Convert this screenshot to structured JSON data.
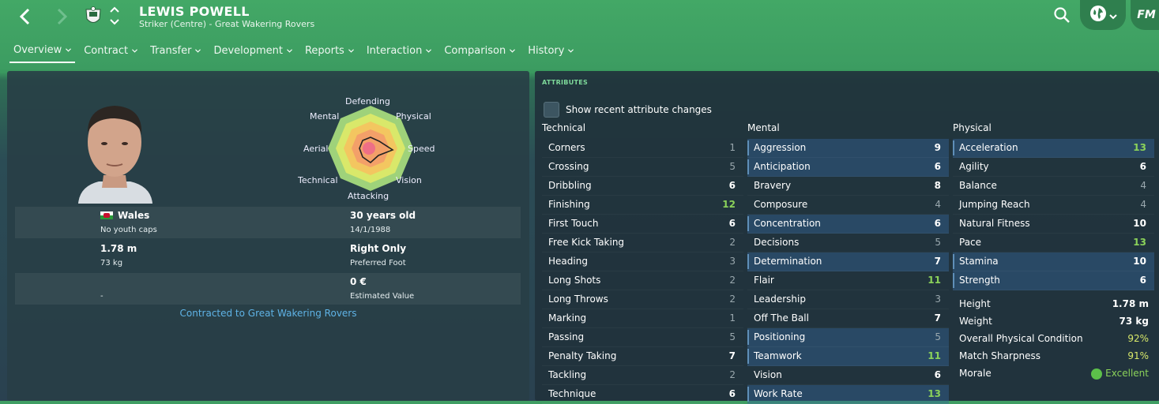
{
  "header": {
    "player_name": "LEWIS POWELL",
    "subtitle": "Striker (Centre) - Great Wakering Rovers",
    "logo_text": "FM"
  },
  "tabs": [
    {
      "label": "Overview",
      "active": true
    },
    {
      "label": "Contract"
    },
    {
      "label": "Transfer"
    },
    {
      "label": "Development"
    },
    {
      "label": "Reports"
    },
    {
      "label": "Interaction"
    },
    {
      "label": "Comparison"
    },
    {
      "label": "History"
    }
  ],
  "radar": {
    "labels": {
      "defending": "Defending",
      "physical": "Physical",
      "speed": "Speed",
      "vision": "Vision",
      "attacking": "Attacking",
      "technical": "Technical",
      "aerial": "Aerial",
      "mental": "Mental"
    }
  },
  "profile": {
    "nationality": "Wales",
    "youth_caps": "No youth caps",
    "age": "30 years old",
    "dob": "14/1/1988",
    "height": "1.78 m",
    "weight": "73 kg",
    "foot": "Right Only",
    "foot_label": "Preferred Foot",
    "value": "0 €",
    "value_label": "Estimated Value",
    "unknown": "-",
    "contract": "Contracted to Great Wakering Rovers"
  },
  "attributes": {
    "title": "ATTRIBUTES",
    "show_changes": "Show recent attribute changes",
    "technical_head": "Technical",
    "mental_head": "Mental",
    "physical_head": "Physical",
    "technical": [
      {
        "name": "Corners",
        "value": "1"
      },
      {
        "name": "Crossing",
        "value": "5"
      },
      {
        "name": "Dribbling",
        "value": "6"
      },
      {
        "name": "Finishing",
        "value": "12"
      },
      {
        "name": "First Touch",
        "value": "6"
      },
      {
        "name": "Free Kick Taking",
        "value": "2"
      },
      {
        "name": "Heading",
        "value": "3"
      },
      {
        "name": "Long Shots",
        "value": "2"
      },
      {
        "name": "Long Throws",
        "value": "2"
      },
      {
        "name": "Marking",
        "value": "1"
      },
      {
        "name": "Passing",
        "value": "5"
      },
      {
        "name": "Penalty Taking",
        "value": "7"
      },
      {
        "name": "Tackling",
        "value": "2"
      },
      {
        "name": "Technique",
        "value": "6"
      }
    ],
    "mental": [
      {
        "name": "Aggression",
        "value": "9"
      },
      {
        "name": "Anticipation",
        "value": "6"
      },
      {
        "name": "Bravery",
        "value": "8"
      },
      {
        "name": "Composure",
        "value": "4"
      },
      {
        "name": "Concentration",
        "value": "6"
      },
      {
        "name": "Decisions",
        "value": "5"
      },
      {
        "name": "Determination",
        "value": "7"
      },
      {
        "name": "Flair",
        "value": "11"
      },
      {
        "name": "Leadership",
        "value": "3"
      },
      {
        "name": "Off The Ball",
        "value": "7"
      },
      {
        "name": "Positioning",
        "value": "5"
      },
      {
        "name": "Teamwork",
        "value": "11"
      },
      {
        "name": "Vision",
        "value": "6"
      },
      {
        "name": "Work Rate",
        "value": "13"
      }
    ],
    "physical": [
      {
        "name": "Acceleration",
        "value": "13"
      },
      {
        "name": "Agility",
        "value": "6"
      },
      {
        "name": "Balance",
        "value": "4"
      },
      {
        "name": "Jumping Reach",
        "value": "4"
      },
      {
        "name": "Natural Fitness",
        "value": "10"
      },
      {
        "name": "Pace",
        "value": "13"
      },
      {
        "name": "Stamina",
        "value": "10"
      },
      {
        "name": "Strength",
        "value": "6"
      }
    ],
    "phys_info": [
      {
        "label": "Height",
        "value": "1.78 m"
      },
      {
        "label": "Weight",
        "value": "73 kg"
      },
      {
        "label": "Overall Physical Condition",
        "value": "92%"
      },
      {
        "label": "Match Sharpness",
        "value": "91%"
      },
      {
        "label": "Morale",
        "value": "Excellent"
      }
    ]
  }
}
